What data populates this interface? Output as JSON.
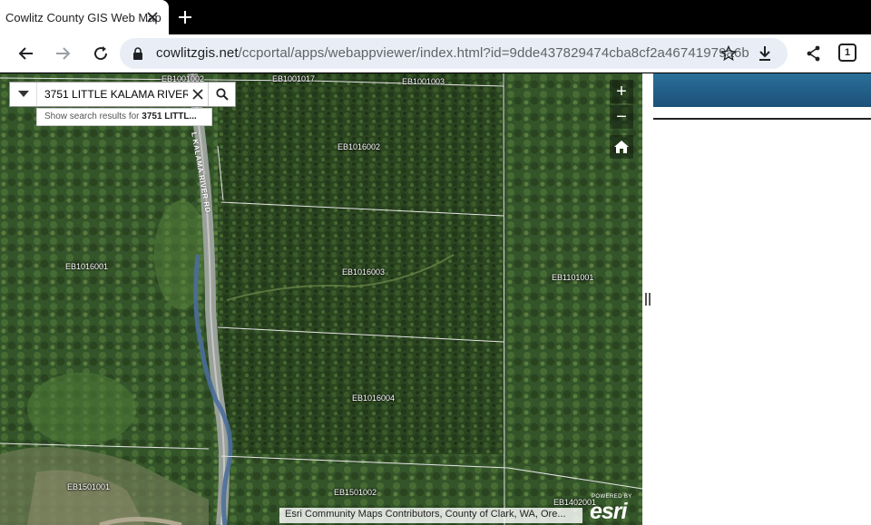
{
  "browser": {
    "tab_title": "Cowlitz County GIS Web Map",
    "url_host": "cowlitzgis.net",
    "url_path": "/ccportal/apps/webappviewer/index.html?id=9dde437829474cba8cf2a46741979a6b",
    "tab_count": "1"
  },
  "search": {
    "value": "3751 LITTLE KALAMA RIVER R",
    "suggestion_prefix": "Show search results for ",
    "suggestion_term": "3751 LITTL..."
  },
  "map": {
    "road_label": "L KALAMA RIVER RD",
    "parcels": {
      "p1": "EB1001002",
      "p2": "EB1001017",
      "p3": "EB1001003",
      "p4": "EB1016002",
      "p5": "EB1016001",
      "p6": "EB1016003",
      "p7": "EB1101001",
      "p8": "EB1016004",
      "p9": "EB1501001",
      "p10": "EB1501002",
      "p11": "EB1402001"
    },
    "zoom_in_label": "+",
    "zoom_out_label": "−",
    "attribution": "Esri Community Maps Contributors, County of Clark, WA, Ore...",
    "esri_powered": "POWERED BY",
    "esri_logo": "esri"
  },
  "colors": {
    "panel_header": "#1f5f88",
    "forest": "#2f4a22"
  }
}
